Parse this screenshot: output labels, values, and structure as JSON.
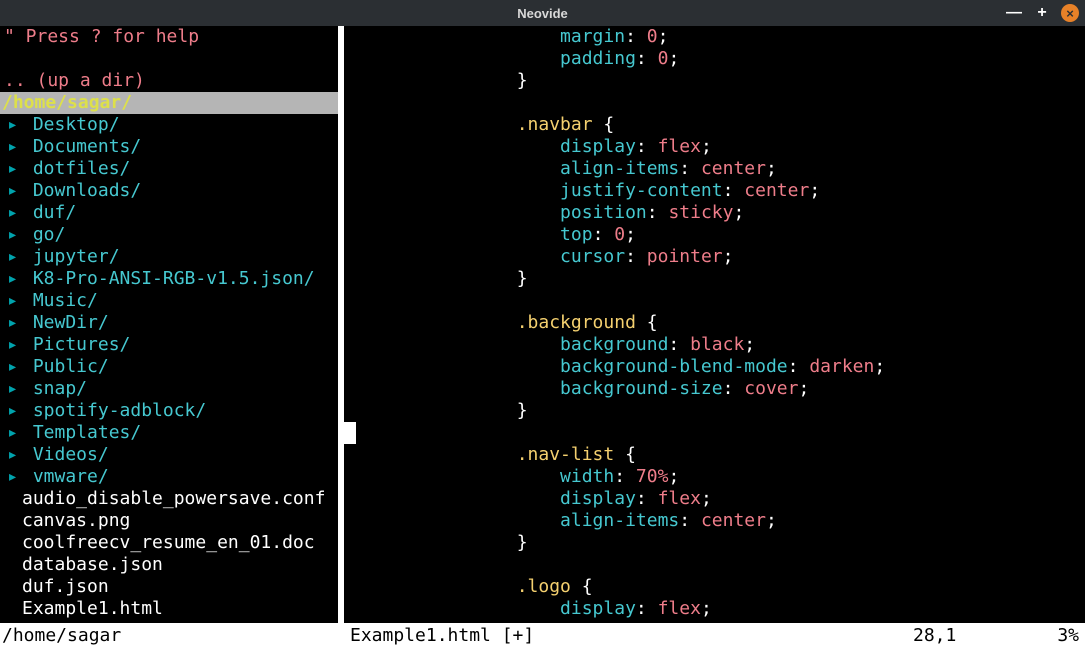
{
  "window": {
    "title": "Neovide",
    "min_glyph": "—",
    "max_glyph": "+",
    "close_glyph": "×"
  },
  "sidebar": {
    "help_line": "\" Press ? for help",
    "up_dir": ".. (up a dir)",
    "cwd": "/home/sagar/",
    "dirs": [
      "Desktop/",
      "Documents/",
      "dotfiles/",
      "Downloads/",
      "duf/",
      "go/",
      "jupyter/",
      "K8-Pro-ANSI-RGB-v1.5.json/",
      "Music/",
      "NewDir/",
      "Pictures/",
      "Public/",
      "snap/",
      "spotify-adblock/",
      "Templates/",
      "Videos/",
      "vmware/"
    ],
    "files": [
      "audio_disable_powersave.conf",
      "canvas.png",
      "coolfreecv_resume_en_01.doc",
      "database.json",
      "duf.json",
      "Example1.html"
    ]
  },
  "code_lines": [
    {
      "indent": 12,
      "t": "prop",
      "prop": "margin",
      "val": "0",
      "semi": true
    },
    {
      "indent": 12,
      "t": "prop",
      "prop": "padding",
      "val": "0",
      "semi": true
    },
    {
      "indent": 8,
      "t": "brace_close"
    },
    {
      "indent": 0,
      "t": "blank"
    },
    {
      "indent": 8,
      "t": "sel_open",
      "sel": ".navbar"
    },
    {
      "indent": 12,
      "t": "prop",
      "prop": "display",
      "val": "flex",
      "semi": true
    },
    {
      "indent": 12,
      "t": "prop",
      "prop": "align-items",
      "val": "center",
      "semi": true
    },
    {
      "indent": 12,
      "t": "prop",
      "prop": "justify-content",
      "val": "center",
      "semi": true
    },
    {
      "indent": 12,
      "t": "prop",
      "prop": "position",
      "val": "sticky",
      "semi": true
    },
    {
      "indent": 12,
      "t": "prop",
      "prop": "top",
      "val": "0",
      "semi": true
    },
    {
      "indent": 12,
      "t": "prop",
      "prop": "cursor",
      "val": "pointer",
      "semi": true
    },
    {
      "indent": 8,
      "t": "brace_close"
    },
    {
      "indent": 0,
      "t": "blank"
    },
    {
      "indent": 8,
      "t": "sel_open",
      "sel": ".background"
    },
    {
      "indent": 12,
      "t": "prop",
      "prop": "background",
      "val": "black",
      "semi": true
    },
    {
      "indent": 12,
      "t": "prop",
      "prop": "background-blend-mode",
      "val": "darken",
      "semi": true
    },
    {
      "indent": 12,
      "t": "prop",
      "prop": "background-size",
      "val": "cover",
      "semi": true
    },
    {
      "indent": 8,
      "t": "brace_close"
    },
    {
      "indent": 0,
      "t": "blank"
    },
    {
      "indent": 8,
      "t": "sel_open",
      "sel": ".nav-list"
    },
    {
      "indent": 12,
      "t": "prop",
      "prop": "width",
      "val": "70%",
      "semi": true
    },
    {
      "indent": 12,
      "t": "prop",
      "prop": "display",
      "val": "flex",
      "semi": true
    },
    {
      "indent": 12,
      "t": "prop",
      "prop": "align-items",
      "val": "center",
      "semi": true
    },
    {
      "indent": 8,
      "t": "brace_close"
    },
    {
      "indent": 0,
      "t": "blank"
    },
    {
      "indent": 8,
      "t": "sel_open",
      "sel": ".logo"
    },
    {
      "indent": 12,
      "t": "prop",
      "prop": "display",
      "val": "flex",
      "semi": true
    }
  ],
  "status": {
    "left": "/home/sagar",
    "file": "Example1.html [+]",
    "pos": "28,1",
    "pct": "3%"
  }
}
